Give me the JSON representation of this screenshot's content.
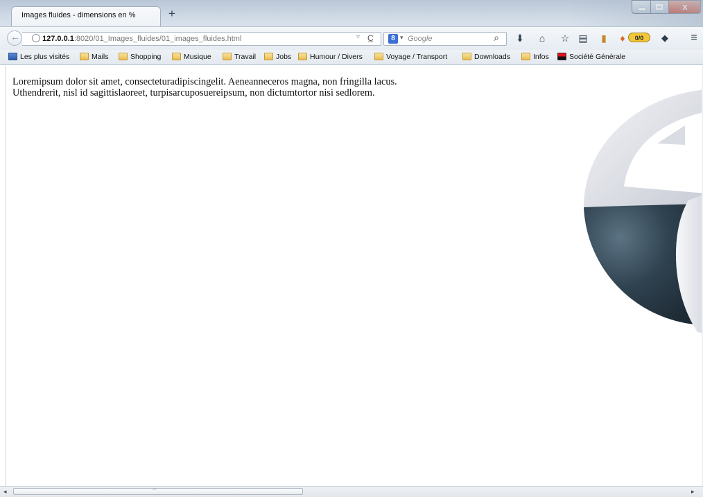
{
  "browser": {
    "tab_title": "Images fluides - dimensions en %",
    "new_tab_label": "+",
    "close_symbol": "x",
    "url_host": "127.0.0.1",
    "url_path": ":8020/01_Images_fluides/01_images_fluides.html",
    "search_engine_badge": "8",
    "search_placeholder": "Google",
    "addon_counter": "0/0"
  },
  "bookmarks": [
    {
      "label": "Les plus visités",
      "icon": "most-visited-icon"
    },
    {
      "label": "Mails",
      "icon": "folder-icon"
    },
    {
      "label": "Shopping",
      "icon": "folder-icon"
    },
    {
      "label": "Musique",
      "icon": "folder-icon"
    },
    {
      "label": "Travail",
      "icon": "folder-icon"
    },
    {
      "label": "Jobs",
      "icon": "folder-icon"
    },
    {
      "label": "Humour / Divers",
      "icon": "folder-icon"
    },
    {
      "label": "Voyage / Transport",
      "icon": "folder-icon"
    },
    {
      "label": "Downloads",
      "icon": "folder-icon"
    },
    {
      "label": "Infos",
      "icon": "folder-icon"
    },
    {
      "label": "Société Générale",
      "icon": "societe-generale-icon"
    }
  ],
  "page": {
    "paragraph": "Loremipsum dolor sit amet, consecteturadipiscingelit. Aeneanneceros magna, non fringilla lacus. Uthendrerit, nisl id sagittislaoreet, turpisarcuposuereipsum, non dictumtortor nisi sedlorem."
  },
  "colors": {
    "chrome": "#dde5ee",
    "close_button": "#c8452f",
    "sphere_dark": "#2f4250",
    "sphere_light": "#e4e6ec"
  }
}
